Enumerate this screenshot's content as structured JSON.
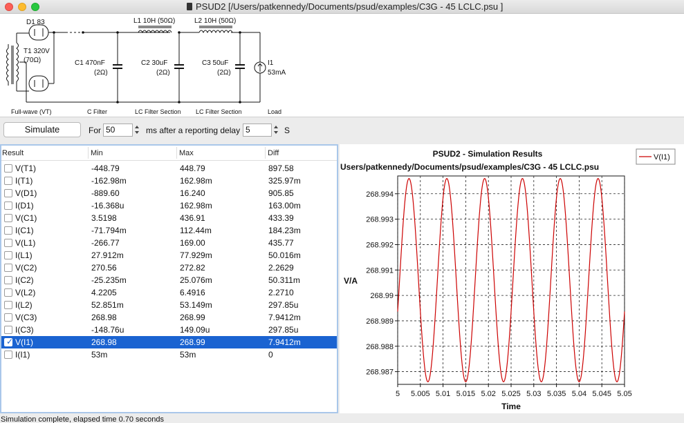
{
  "window": {
    "title": "PSUD2  [/Users/patkennedy/Documents/psud/examples/C3G - 45 LCLC.psu ]"
  },
  "schematic": {
    "rectifier": {
      "label": "D1 83",
      "section": "Full-wave (VT)"
    },
    "transformer": {
      "label": "T1 320V",
      "resistance": "(70Ω)"
    },
    "c1": {
      "label": "C1 470nF",
      "resistance": "(2Ω)",
      "section": "C Filter"
    },
    "l1": {
      "label": "L1 10H (50Ω)"
    },
    "c2": {
      "label": "C2 30uF",
      "resistance": "(2Ω)",
      "section": "LC Filter Section"
    },
    "l2": {
      "label": "L2 10H (50Ω)"
    },
    "c3": {
      "label": "C3 50uF",
      "resistance": "(2Ω)",
      "section": "LC Filter Section"
    },
    "load": {
      "label": "I1",
      "value": "53mA",
      "section": "Load"
    }
  },
  "toolbar": {
    "simulate_label": "Simulate",
    "for_label": "For",
    "duration_value": "50",
    "duration_unit": "ms after a reporting delay",
    "delay_value": "5",
    "delay_unit": "S"
  },
  "results": {
    "columns": [
      "Result",
      "Min",
      "Max",
      "Diff"
    ],
    "rows": [
      {
        "name": "V(T1)",
        "min": "-448.79",
        "max": "448.79",
        "diff": "897.58",
        "checked": false
      },
      {
        "name": "I(T1)",
        "min": "-162.98m",
        "max": "162.98m",
        "diff": "325.97m",
        "checked": false
      },
      {
        "name": "V(D1)",
        "min": "-889.60",
        "max": "16.240",
        "diff": "905.85",
        "checked": false
      },
      {
        "name": "I(D1)",
        "min": "-16.368u",
        "max": "162.98m",
        "diff": "163.00m",
        "checked": false
      },
      {
        "name": "V(C1)",
        "min": "3.5198",
        "max": "436.91",
        "diff": "433.39",
        "checked": false
      },
      {
        "name": "I(C1)",
        "min": "-71.794m",
        "max": "112.44m",
        "diff": "184.23m",
        "checked": false
      },
      {
        "name": "V(L1)",
        "min": "-266.77",
        "max": "169.00",
        "diff": "435.77",
        "checked": false
      },
      {
        "name": "I(L1)",
        "min": "27.912m",
        "max": "77.929m",
        "diff": "50.016m",
        "checked": false
      },
      {
        "name": "V(C2)",
        "min": "270.56",
        "max": "272.82",
        "diff": "2.2629",
        "checked": false
      },
      {
        "name": "I(C2)",
        "min": "-25.235m",
        "max": "25.076m",
        "diff": "50.311m",
        "checked": false
      },
      {
        "name": "V(L2)",
        "min": "4.2205",
        "max": "6.4916",
        "diff": "2.2710",
        "checked": false
      },
      {
        "name": "I(L2)",
        "min": "52.851m",
        "max": "53.149m",
        "diff": "297.85u",
        "checked": false
      },
      {
        "name": "V(C3)",
        "min": "268.98",
        "max": "268.99",
        "diff": "7.9412m",
        "checked": false
      },
      {
        "name": "I(C3)",
        "min": "-148.76u",
        "max": "149.09u",
        "diff": "297.85u",
        "checked": false
      },
      {
        "name": "V(I1)",
        "min": "268.98",
        "max": "268.99",
        "diff": "7.9412m",
        "checked": true,
        "selected": true
      },
      {
        "name": "I(I1)",
        "min": "53m",
        "max": "53m",
        "diff": "0",
        "checked": false
      }
    ]
  },
  "chart_data": {
    "type": "line",
    "title": "PSUD2 - Simulation Results",
    "subtitle": "Users/patkennedy/Documents/psud/examples/C3G - 45 LCLC.psu",
    "xlabel": "Time",
    "ylabel": "V/A",
    "xlim": [
      5,
      5.05
    ],
    "ylim": [
      268.9865,
      268.9947
    ],
    "xticks": [
      "5",
      "5.005",
      "5.01",
      "5.015",
      "5.02",
      "5.025",
      "5.03",
      "5.035",
      "5.04",
      "5.045",
      "5.05"
    ],
    "yticks": [
      "268.987",
      "268.988",
      "268.989",
      "268.99",
      "268.991",
      "268.992",
      "268.993",
      "268.994"
    ],
    "grid": true,
    "legend_position": "top-right",
    "series": [
      {
        "name": "V(I1)",
        "color": "#cc0000",
        "waveform": "sine",
        "frequency_hz": 120,
        "min": 268.9866,
        "max": 268.9946,
        "first_peak_time": 5.0025
      }
    ]
  },
  "status": {
    "text": "Simulation complete, elapsed time 0.70 seconds"
  }
}
